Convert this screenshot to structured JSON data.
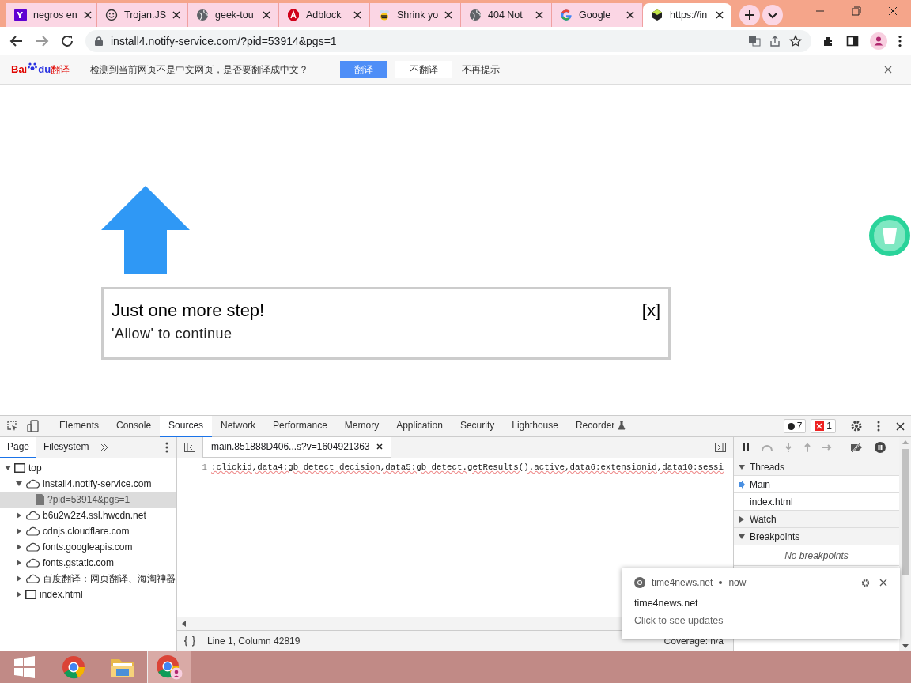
{
  "browser": {
    "tabs": [
      {
        "title": "negros en",
        "kind": "yahoo",
        "selected": false
      },
      {
        "title": "Trojan.JS",
        "kind": "smiley",
        "selected": false
      },
      {
        "title": "geek-tou",
        "kind": "globe",
        "selected": false
      },
      {
        "title": "Adblock",
        "kind": "adblock",
        "selected": false
      },
      {
        "title": "Shrink yo",
        "kind": "bee",
        "selected": false
      },
      {
        "title": "404 Not",
        "kind": "globe",
        "selected": false
      },
      {
        "title": "Google",
        "kind": "google",
        "selected": false
      },
      {
        "title": "https://in",
        "kind": "cube",
        "selected": true
      }
    ],
    "url": "install4.notify-service.com/?pid=53914&pgs=1"
  },
  "translate_bar": {
    "logo": [
      "Bai",
      "du",
      "翻译"
    ],
    "message": "检测到当前网页不是中文网页，是否要翻译成中文？",
    "buttons": [
      {
        "label": "翻译",
        "kind": "primary"
      },
      {
        "label": "不翻译",
        "kind": "plain"
      },
      {
        "label": "不再提示",
        "kind": "link"
      }
    ]
  },
  "page": {
    "title": "Just one more step!",
    "subtitle": "'Allow' to continue",
    "close": "[x]"
  },
  "devtools": {
    "panels": [
      {
        "label": "Elements",
        "selected": false
      },
      {
        "label": "Console",
        "selected": false
      },
      {
        "label": "Sources",
        "selected": true
      },
      {
        "label": "Network",
        "selected": false
      },
      {
        "label": "Performance",
        "selected": false
      },
      {
        "label": "Memory",
        "selected": false
      },
      {
        "label": "Application",
        "selected": false
      },
      {
        "label": "Security",
        "selected": false
      },
      {
        "label": "Lighthouse",
        "selected": false
      },
      {
        "label": "Recorder",
        "selected": false
      }
    ],
    "issues": {
      "messages": "7",
      "errors": "1"
    },
    "navigator_tabs": [
      {
        "label": "Page",
        "selected": true
      },
      {
        "label": "Filesystem",
        "selected": false
      }
    ],
    "tree": [
      {
        "label": "top",
        "kind": "frame",
        "expanded": true,
        "selected": false,
        "children": [
          {
            "label": "install4.notify-service.com",
            "kind": "cloud",
            "expanded": true,
            "selected": false,
            "children": [
              {
                "label": "?pid=53914&pgs=1",
                "kind": "file",
                "selected": true
              }
            ]
          },
          {
            "label": "b6u2w2z4.ssl.hwcdn.net",
            "kind": "cloud",
            "expanded": false,
            "selected": false
          },
          {
            "label": "cdnjs.cloudflare.com",
            "kind": "cloud",
            "expanded": false,
            "selected": false
          },
          {
            "label": "fonts.googleapis.com",
            "kind": "cloud",
            "expanded": false,
            "selected": false
          },
          {
            "label": "fonts.gstatic.com",
            "kind": "cloud",
            "expanded": false,
            "selected": false
          },
          {
            "label": "百度翻译：网页翻译、海淘神器",
            "kind": "cloud",
            "expanded": false,
            "selected": false
          },
          {
            "label": "index.html",
            "kind": "frame",
            "expanded": false,
            "selected": false
          }
        ]
      }
    ],
    "editor_tab": "main.851888D406...s?v=1604921363",
    "code": [
      {
        "number": "1",
        "text": ":clickid,data4:gb_detect_decision,data5:gb_detect.getResults().active,data6:extensionid,data10:sessi"
      }
    ],
    "status": {
      "position": "Line 1, Column 42819",
      "coverage": "Coverage: n/a"
    },
    "sections": [
      {
        "title": "Threads",
        "expanded": true,
        "items": [
          {
            "label": "Main",
            "current": true
          },
          {
            "label": "index.html",
            "current": false
          }
        ]
      },
      {
        "title": "Watch",
        "expanded": false
      },
      {
        "title": "Breakpoints",
        "expanded": true,
        "empty": "No breakpoints"
      }
    ]
  },
  "notification": {
    "source": "time4news.net",
    "time": "now",
    "title": "time4news.net",
    "body": "Click to see updates"
  },
  "taskbar": [
    {
      "kind": "start",
      "active": false
    },
    {
      "kind": "chrome",
      "active": false
    },
    {
      "kind": "folder",
      "active": false
    },
    {
      "kind": "chrome-profile",
      "active": true
    }
  ]
}
